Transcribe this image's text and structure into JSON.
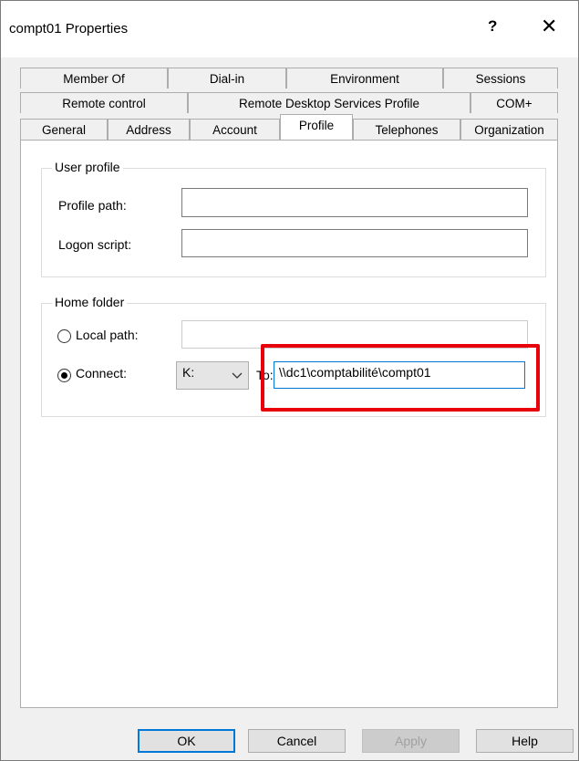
{
  "window": {
    "title": "compt01 Properties",
    "help_label": "?",
    "close_label": "✕"
  },
  "tabs": {
    "row1": [
      "Member Of",
      "Dial-in",
      "Environment",
      "Sessions"
    ],
    "row2": [
      "Remote control",
      "Remote Desktop Services Profile",
      "COM+"
    ],
    "row3": [
      "General",
      "Address",
      "Account",
      "Profile",
      "Telephones",
      "Organization"
    ],
    "active": "Profile"
  },
  "user_profile": {
    "legend": "User profile",
    "profile_path_label": "Profile path:",
    "profile_path_value": "",
    "logon_script_label": "Logon script:",
    "logon_script_value": ""
  },
  "home_folder": {
    "legend": "Home folder",
    "local_path_label": "Local path:",
    "local_path_value": "",
    "connect_label": "Connect:",
    "drive_value": "K:",
    "to_label": "To:",
    "to_value": "\\\\dc1\\comptabilité\\compt01",
    "selected": "connect"
  },
  "buttons": {
    "ok": "OK",
    "cancel": "Cancel",
    "apply": "Apply",
    "help": "Help"
  },
  "colors": {
    "highlight": "#e8000b",
    "focus": "#0078d7"
  },
  "icons": {
    "radio_selected": "radio-selected-icon",
    "dropdown": "chevron-down-icon"
  }
}
